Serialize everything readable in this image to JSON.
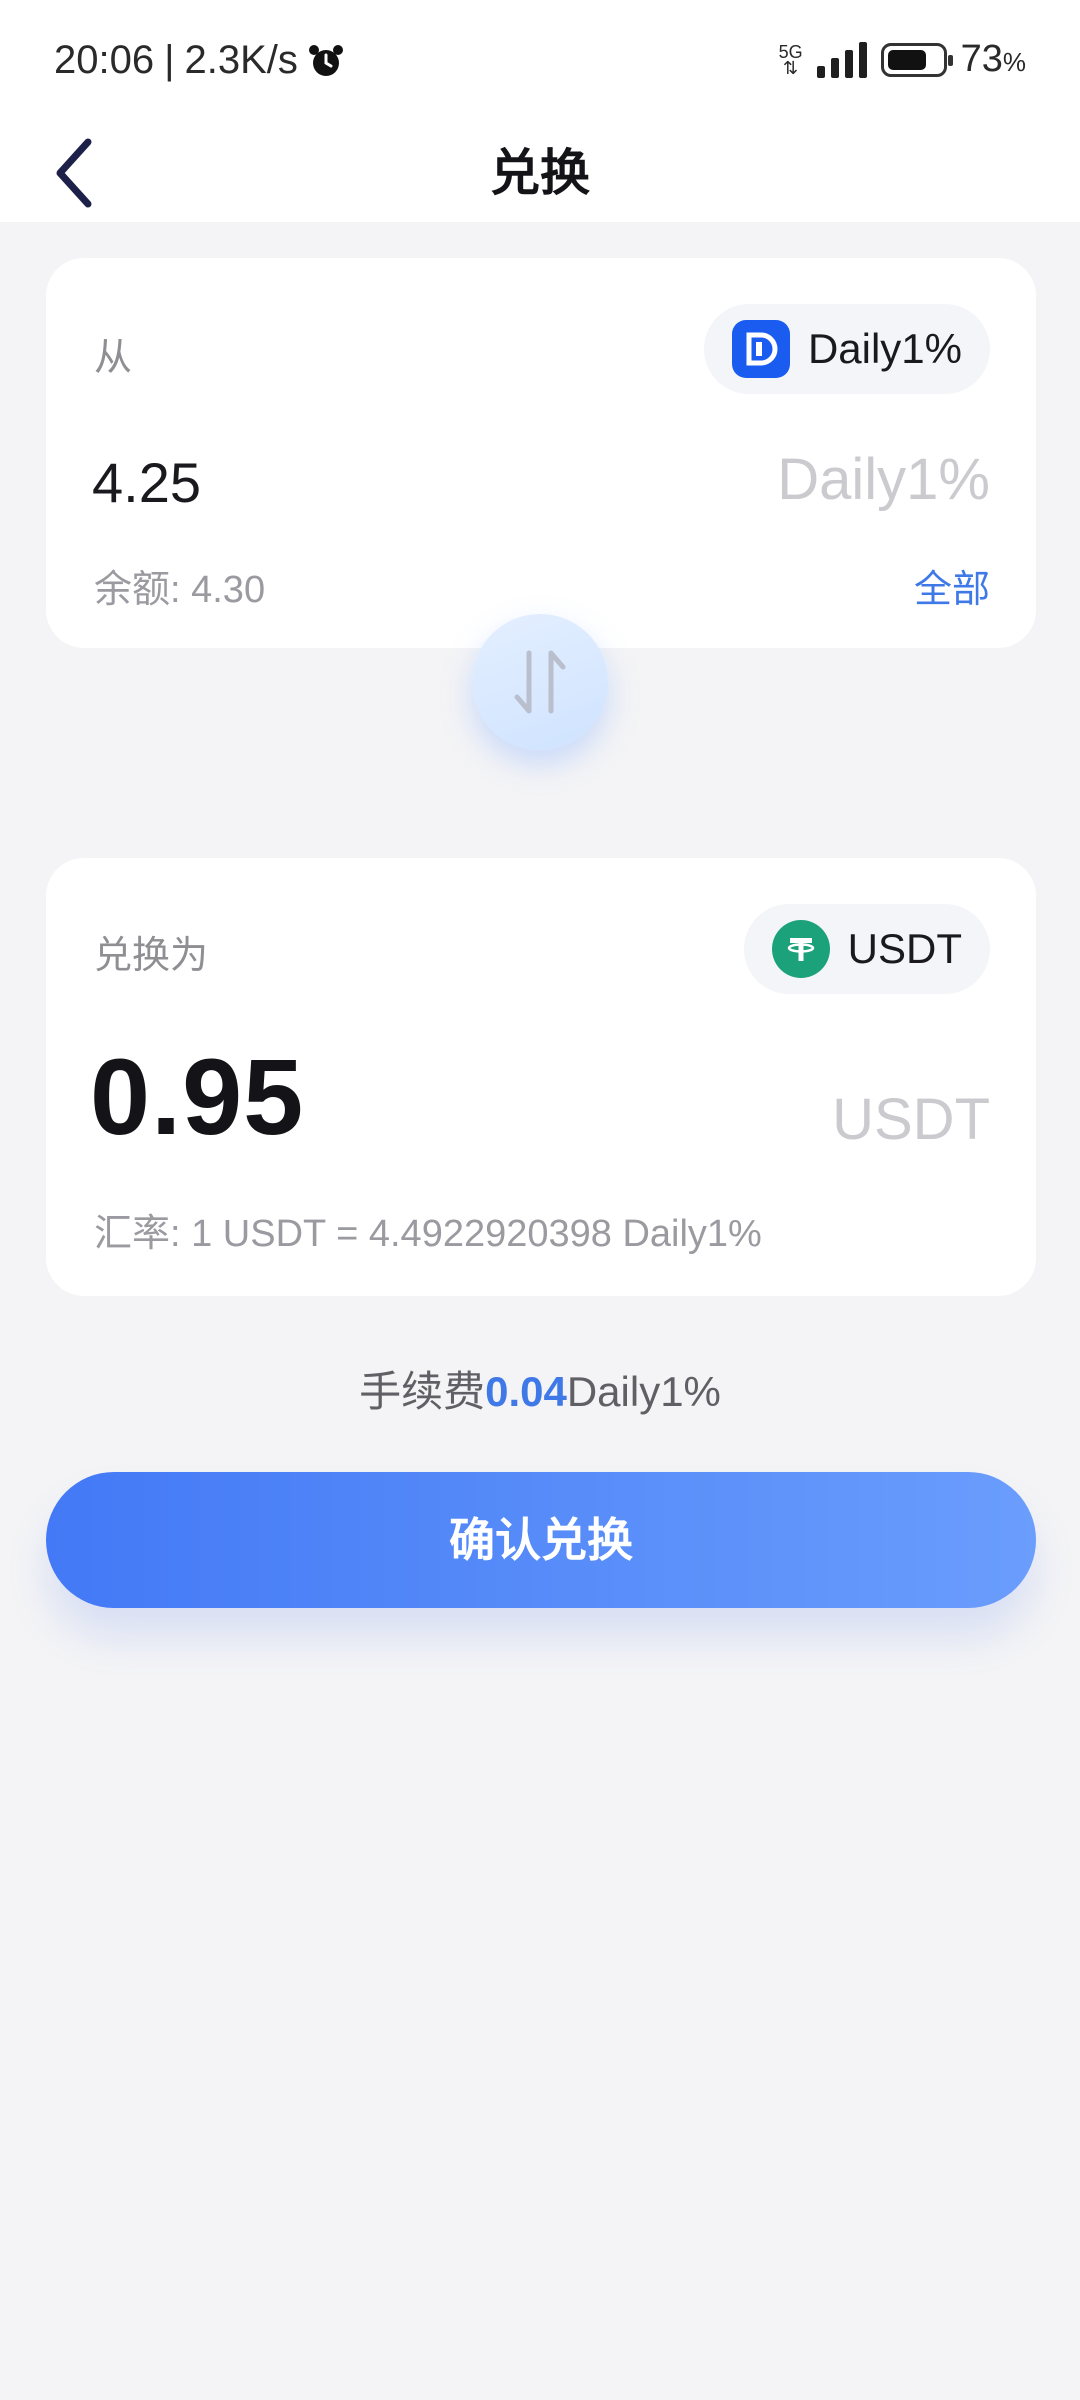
{
  "status_bar": {
    "time": "20:06",
    "net_speed": "2.3K/s",
    "network": "5G",
    "battery_pct": "73",
    "battery_unit": "%",
    "battery_level": 0.73
  },
  "header": {
    "title": "兑换"
  },
  "from_card": {
    "label": "从",
    "token_name": "Daily1%",
    "amount": "4.25",
    "unit": "Daily1%",
    "balance": "余额: 4.30",
    "all_label": "全部",
    "token_color": "#1a5cf0"
  },
  "to_card": {
    "label": "兑换为",
    "token_name": "USDT",
    "amount": "0.95",
    "unit": "USDT",
    "rate": "汇率: 1 USDT = 4.4922920398 Daily1%",
    "token_color": "#1ba27a"
  },
  "fee": {
    "label": "手续费",
    "value": "0.04",
    "unit": "Daily1%"
  },
  "confirm_button": {
    "label": "确认兑换"
  },
  "icons": {
    "back": "chevron-left-icon",
    "swap": "swap-arrows-icon",
    "alarm": "alarm-icon",
    "from_token": "daily-token-icon",
    "to_token": "usdt-tether-icon"
  }
}
